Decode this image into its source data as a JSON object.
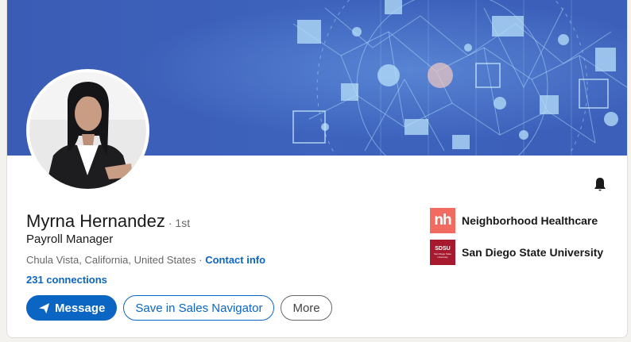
{
  "profile": {
    "name": "Myrna Hernandez",
    "degree": "· 1st",
    "headline": "Payroll Manager",
    "location": "Chula Vista, California, United States",
    "location_separator": " · ",
    "contact_info_label": "Contact info",
    "connections_label": "231 connections"
  },
  "actions": {
    "message_label": "Message",
    "save_navigator_label": "Save in Sales Navigator",
    "more_label": "More"
  },
  "organizations": [
    {
      "name": "Neighborhood Healthcare",
      "logo_text": "nh",
      "logo_color": "#f26b60"
    },
    {
      "name": "San Diego State University",
      "logo_text": "SDSU",
      "logo_subtext": "San Diego State University",
      "logo_color": "#a6192e"
    }
  ],
  "icons": {
    "notification": "bell-icon",
    "message": "send-icon"
  },
  "colors": {
    "accent": "#0a66c2",
    "banner": "#3d5fb8"
  }
}
